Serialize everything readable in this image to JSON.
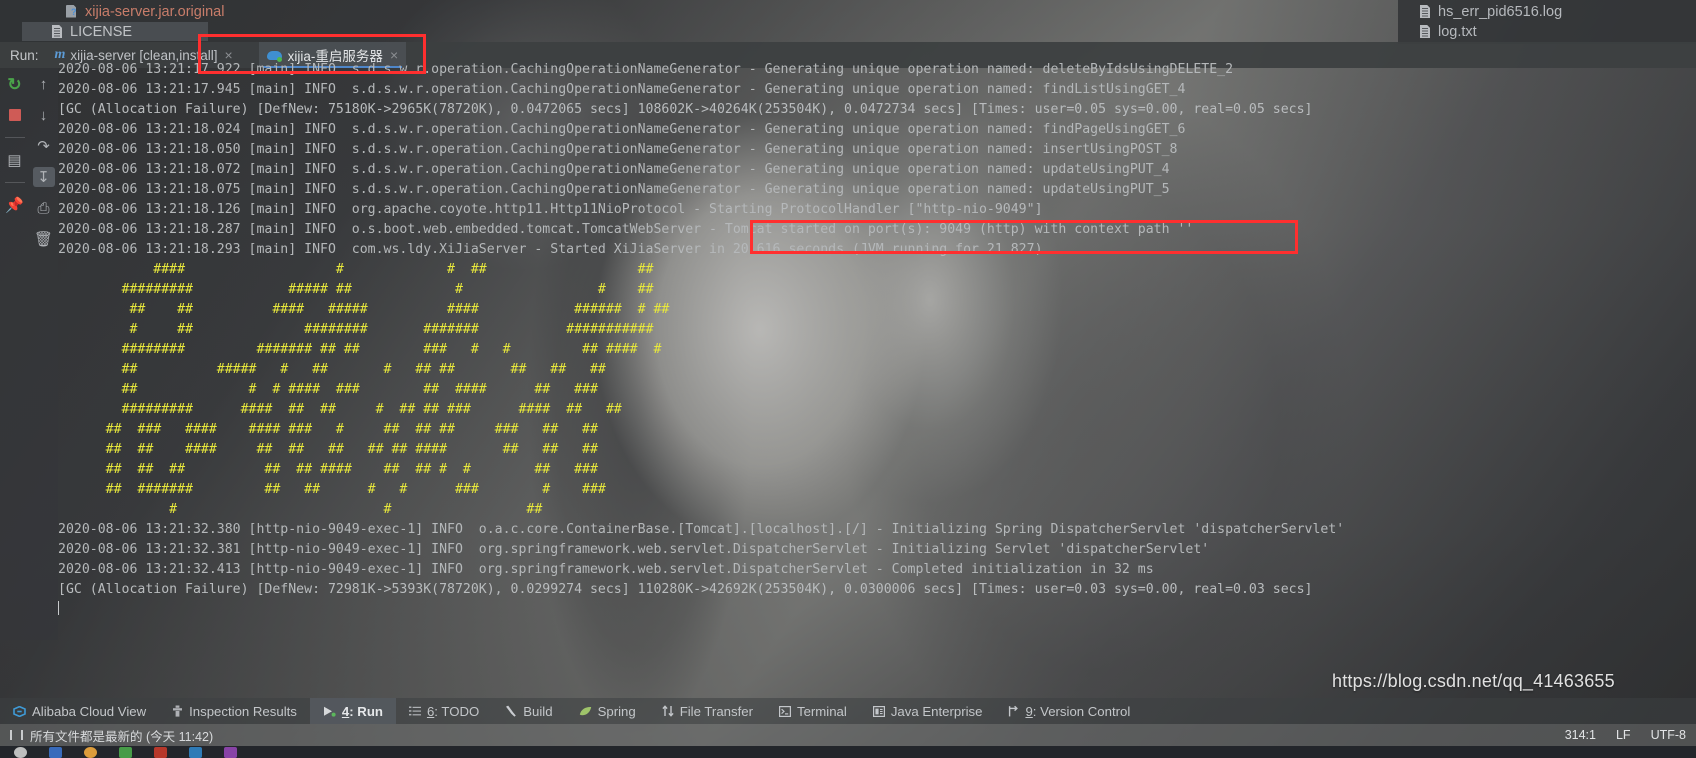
{
  "project_tree": {
    "left_files": [
      {
        "name": "xijia-server.jar.original",
        "icon": "jar-file-icon"
      },
      {
        "name": "LICENSE",
        "icon": "file-icon"
      }
    ],
    "right_files": [
      {
        "name": "hs_err_pid6516.log",
        "icon": "file-icon"
      },
      {
        "name": "log.txt",
        "icon": "file-icon"
      }
    ]
  },
  "run_window": {
    "label": "Run:",
    "tabs": [
      {
        "label": "xijia-server [clean,install]",
        "icon": "maven-m-icon",
        "active": false,
        "close": "×"
      },
      {
        "label": "xijia-重启服务器",
        "icon": "alibaba-cloud-icon",
        "active": true,
        "close": "×"
      }
    ],
    "toolbar_left": [
      {
        "name": "rerun-icon",
        "glyph": "↻"
      },
      {
        "name": "stop-icon",
        "glyph": ""
      },
      {
        "name": "layout-icon",
        "glyph": "▤"
      },
      {
        "name": "pin-icon",
        "glyph": "📌"
      }
    ],
    "toolbar_right": [
      {
        "name": "up-arrow-icon",
        "glyph": "↑"
      },
      {
        "name": "down-arrow-icon",
        "glyph": "↓"
      },
      {
        "name": "soft-wrap-icon",
        "glyph": "↵"
      },
      {
        "name": "scroll-to-end-icon",
        "glyph": "↧"
      },
      {
        "name": "print-icon",
        "glyph": "⎙"
      },
      {
        "name": "trash-icon",
        "glyph": "🗑"
      }
    ]
  },
  "console": {
    "lines": [
      {
        "type": "log",
        "text": "2020-08-06 13:21:17.922 [main] INFO  s.d.s.w.r.operation.CachingOperationNameGenerator - Generating unique operation named: deleteByIdsUsingDELETE_2"
      },
      {
        "type": "log",
        "text": "2020-08-06 13:21:17.945 [main] INFO  s.d.s.w.r.operation.CachingOperationNameGenerator - Generating unique operation named: findListUsingGET_4"
      },
      {
        "type": "gc",
        "text": "[GC (Allocation Failure) [DefNew: 75180K->2965K(78720K), 0.0472065 secs] 108602K->40264K(253504K), 0.0472734 secs] [Times: user=0.05 sys=0.00, real=0.05 secs]"
      },
      {
        "type": "log",
        "text": "2020-08-06 13:21:18.024 [main] INFO  s.d.s.w.r.operation.CachingOperationNameGenerator - Generating unique operation named: findPageUsingGET_6"
      },
      {
        "type": "log",
        "text": "2020-08-06 13:21:18.050 [main] INFO  s.d.s.w.r.operation.CachingOperationNameGenerator - Generating unique operation named: insertUsingPOST_8"
      },
      {
        "type": "log",
        "text": "2020-08-06 13:21:18.072 [main] INFO  s.d.s.w.r.operation.CachingOperationNameGenerator - Generating unique operation named: updateUsingPUT_4"
      },
      {
        "type": "log",
        "text": "2020-08-06 13:21:18.075 [main] INFO  s.d.s.w.r.operation.CachingOperationNameGenerator - Generating unique operation named: updateUsingPUT_5"
      },
      {
        "type": "log",
        "text": "2020-08-06 13:21:18.126 [main] INFO  org.apache.coyote.http11.Http11NioProtocol - Starting ProtocolHandler [\"http-nio-9049\"]"
      },
      {
        "type": "log",
        "text": "2020-08-06 13:21:18.287 [main] INFO  o.s.boot.web.embedded.tomcat.TomcatWebServer - Tomcat started on port(s): 9049 (http) with context path ''"
      },
      {
        "type": "log",
        "text": "2020-08-06 13:21:18.293 [main] INFO  com.ws.ldy.XiJiaServer - Started XiJiaServer in 20.616 seconds (JVM running for 21.827)"
      },
      {
        "type": "art",
        "text": "            ####                   #             #  ##                   ##"
      },
      {
        "type": "art",
        "text": "        #########            ##### ##             #                 #    ##"
      },
      {
        "type": "art",
        "text": "         ##    ##          ####   #####          ####            ######  # ##"
      },
      {
        "type": "art",
        "text": "         #     ##              ########       #######           ###########"
      },
      {
        "type": "art",
        "text": "        ########         ####### ## ##        ###   #   #         ## ####  #"
      },
      {
        "type": "art",
        "text": "        ##          #####   #   ##       #   ## ##       ##   ##   ##"
      },
      {
        "type": "art",
        "text": "        ##              #  # ####  ###        ##  ####      ##   ###"
      },
      {
        "type": "art",
        "text": "        #########      ####  ##  ##     #  ## ## ###      ####  ##   ##"
      },
      {
        "type": "art",
        "text": "      ##  ###   ####    #### ###   #     ##  ## ##     ###   ##   ##"
      },
      {
        "type": "art",
        "text": "      ##  ##    ####     ##  ##   ##   ## ## ####       ##   ##   ##"
      },
      {
        "type": "art",
        "text": "      ##  ##  ##          ##  ## ####    ##  ## #  #        ##   ###"
      },
      {
        "type": "art",
        "text": "      ##  #######         ##   ##      #   #      ###        #    ###"
      },
      {
        "type": "art",
        "text": "              #                          #                 ##"
      },
      {
        "type": "log",
        "text": "2020-08-06 13:21:32.380 [http-nio-9049-exec-1] INFO  o.a.c.core.ContainerBase.[Tomcat].[localhost].[/] - Initializing Spring DispatcherServlet 'dispatcherServlet'"
      },
      {
        "type": "log",
        "text": "2020-08-06 13:21:32.381 [http-nio-9049-exec-1] INFO  org.springframework.web.servlet.DispatcherServlet - Initializing Servlet 'dispatcherServlet'"
      },
      {
        "type": "log",
        "text": "2020-08-06 13:21:32.413 [http-nio-9049-exec-1] INFO  org.springframework.web.servlet.DispatcherServlet - Completed initialization in 32 ms"
      },
      {
        "type": "gc",
        "text": "[GC (Allocation Failure) [DefNew: 72981K->5393K(78720K), 0.0299274 secs] 110280K->42692K(253504K), 0.0300006 secs] [Times: user=0.03 sys=0.00, real=0.03 secs]"
      },
      {
        "type": "caret",
        "text": ""
      }
    ]
  },
  "bottom_tabs": [
    {
      "label": "Alibaba Cloud View",
      "icon": "alibaba-cloud-icon",
      "active": false
    },
    {
      "label": "Inspection Results",
      "icon": "inspection-icon",
      "active": false
    },
    {
      "label": "4: Run",
      "icon": "run-play-icon",
      "active": true
    },
    {
      "label": "6: TODO",
      "icon": "todo-list-icon",
      "active": false
    },
    {
      "label": "Build",
      "icon": "hammer-icon",
      "active": false
    },
    {
      "label": "Spring",
      "icon": "spring-leaf-icon",
      "active": false
    },
    {
      "label": "File Transfer",
      "icon": "transfer-arrows-icon",
      "active": false
    },
    {
      "label": "Terminal",
      "icon": "terminal-icon",
      "active": false
    },
    {
      "label": "Java Enterprise",
      "icon": "java-ee-icon",
      "active": false
    },
    {
      "label": "9: Version Control",
      "icon": "branch-icon",
      "active": false
    }
  ],
  "status_bar": {
    "left_text": "所有文件都是最新的 (今天 11:42)",
    "caret_position": "314:1",
    "line_separator": "LF",
    "encoding": "UTF-8"
  },
  "watermark": "https://blog.csdn.net/qq_41463655",
  "colors": {
    "console_text": "#b5b8ba",
    "ascii_art": "#e8e83c",
    "annotation_red": "#ff2f2f",
    "tab_accent": "#4e86c9",
    "jar_label": "#c87d6a"
  }
}
